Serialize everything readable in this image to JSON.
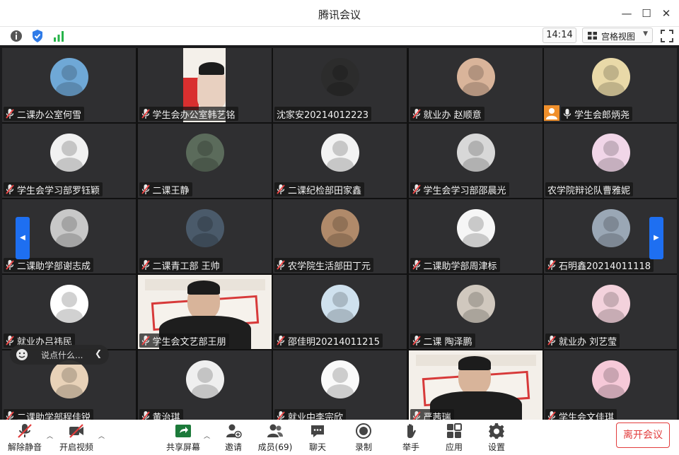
{
  "window": {
    "title": "腾讯会议"
  },
  "toolbar": {
    "time": "14:14",
    "view_label": "宫格视图"
  },
  "participants": [
    "二课办公室何雪",
    "学生会办公室韩艺铭",
    "沈家安20214012223",
    "就业办 赵顺意",
    "学生会郎炳尧",
    "学生会学习部罗钰颖",
    "二课王静",
    "二课纪检部田家鑫",
    "学生会学习部邵晨光",
    "农学院辩论队曹雅妮",
    "二课助学部谢志成",
    "二课青工部 王帅",
    "农学院生活部田丁元",
    "二课助学部周津标",
    "石明鑫20214011118",
    "就业办吕祎民",
    "学生会文艺部王朋",
    "邵佳明20214011215",
    "二课 陶泽鹏",
    "就业办 刘艺莹",
    "二课助学部程佳锐",
    "黄治琪",
    "就业中李宗欣",
    "严茜瑞",
    "学生会文佳琪"
  ],
  "chat": {
    "placeholder": "说点什么..."
  },
  "controls": {
    "mute": "解除静音",
    "video": "开启视频",
    "share": "共享屏幕",
    "invite": "邀请",
    "members": "成员(69)",
    "chat": "聊天",
    "record": "录制",
    "raise_hand": "举手",
    "apps": "应用",
    "settings": "设置",
    "leave": "离开会议"
  }
}
